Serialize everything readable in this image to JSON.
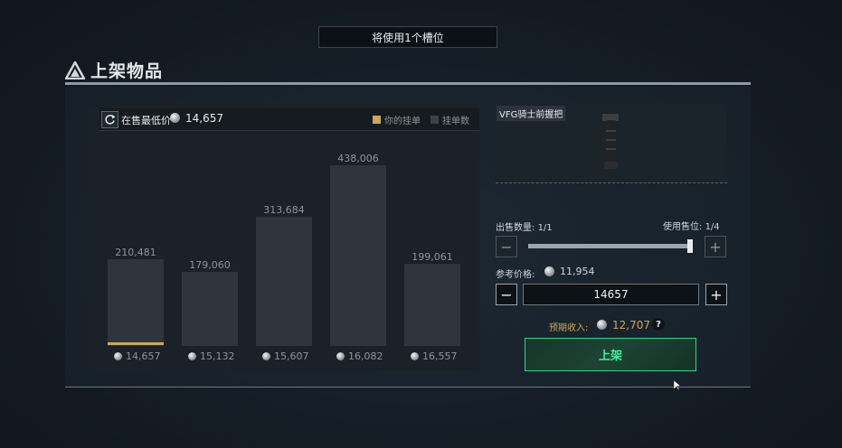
{
  "banner": {
    "text": "将使用1个槽位"
  },
  "header": {
    "title": "上架物品"
  },
  "chart_panel": {
    "lowest_label": "在售最低价",
    "lowest_price": "14,657",
    "legend_yours": "你的挂单",
    "legend_count": "挂单数",
    "colors": {
      "yours": "#c9a85a",
      "count": "#3a4148",
      "bar": "#2e353c"
    }
  },
  "chart_data": {
    "type": "bar",
    "categories": [
      "14,657",
      "15,132",
      "15,607",
      "16,082",
      "16,557"
    ],
    "values": [
      210481,
      179060,
      313684,
      438006,
      199061
    ],
    "value_labels": [
      "210,481",
      "179,060",
      "313,684",
      "438,006",
      "199,061"
    ],
    "highlight_index": 0,
    "title": "",
    "xlabel": "",
    "ylabel": ""
  },
  "item": {
    "name": "VFG骑士前握把",
    "icon": "vertical-foregrip-icon"
  },
  "sell_qty": {
    "label": "出售数量:",
    "value": "1/1"
  },
  "slots_used": {
    "label": "使用售位:",
    "value": "1/4"
  },
  "ref_price": {
    "label": "参考价格:",
    "value": "11,954"
  },
  "price_input": {
    "value": "14657"
  },
  "expected_income": {
    "label": "预期收入:",
    "value": "12,707"
  },
  "help": {
    "text": "?"
  },
  "list_button": {
    "label": "上架"
  },
  "stepper": {
    "minus": "−",
    "plus": "+"
  },
  "slider": {
    "fraction": 1.0
  }
}
